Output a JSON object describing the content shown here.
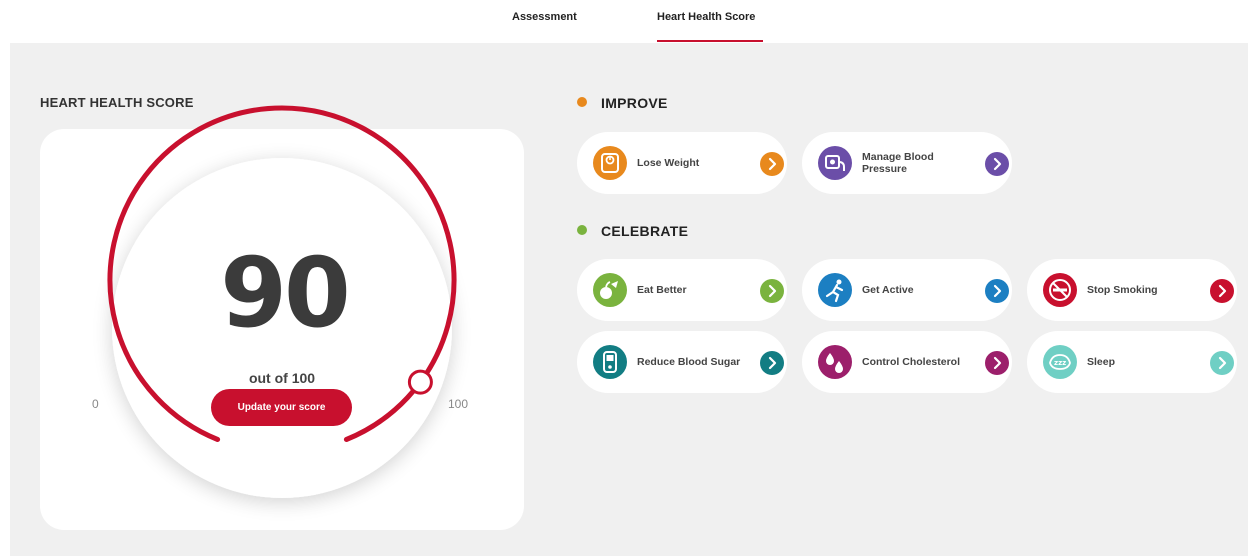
{
  "tabs": [
    {
      "label": "Assessment",
      "active": false
    },
    {
      "label": "Heart Health Score",
      "active": true
    }
  ],
  "score_panel": {
    "title": "HEART HEALTH SCORE",
    "score": "90",
    "out_of": "out of 100",
    "min_label": "0",
    "max_label": "100",
    "update_button": "Update your score",
    "gauge_value": 90
  },
  "improve": {
    "heading": "IMPROVE",
    "color": "#e8891d",
    "items": [
      {
        "label": "Lose Weight",
        "icon": "scale-icon",
        "color": "#e8891d"
      },
      {
        "label": "Manage Blood Pressure",
        "icon": "blood-pressure-icon",
        "color": "#6b4ea8"
      }
    ]
  },
  "celebrate": {
    "heading": "CELEBRATE",
    "color": "#7ab33e",
    "items": [
      {
        "label": "Eat Better",
        "icon": "food-icon",
        "color": "#7ab33e"
      },
      {
        "label": "Get Active",
        "icon": "running-icon",
        "color": "#1c7fc2"
      },
      {
        "label": "Stop Smoking",
        "icon": "no-smoking-icon",
        "color": "#c8102e"
      },
      {
        "label": "Reduce Blood Sugar",
        "icon": "glucose-meter-icon",
        "color": "#127d83"
      },
      {
        "label": "Control Cholesterol",
        "icon": "cholesterol-icon",
        "color": "#9c1f6b"
      },
      {
        "label": "Sleep",
        "icon": "sleep-icon",
        "color": "#6fcfc4"
      }
    ]
  },
  "colors": {
    "brand_red": "#c8102e",
    "panel_bg": "#f0f0f0"
  }
}
